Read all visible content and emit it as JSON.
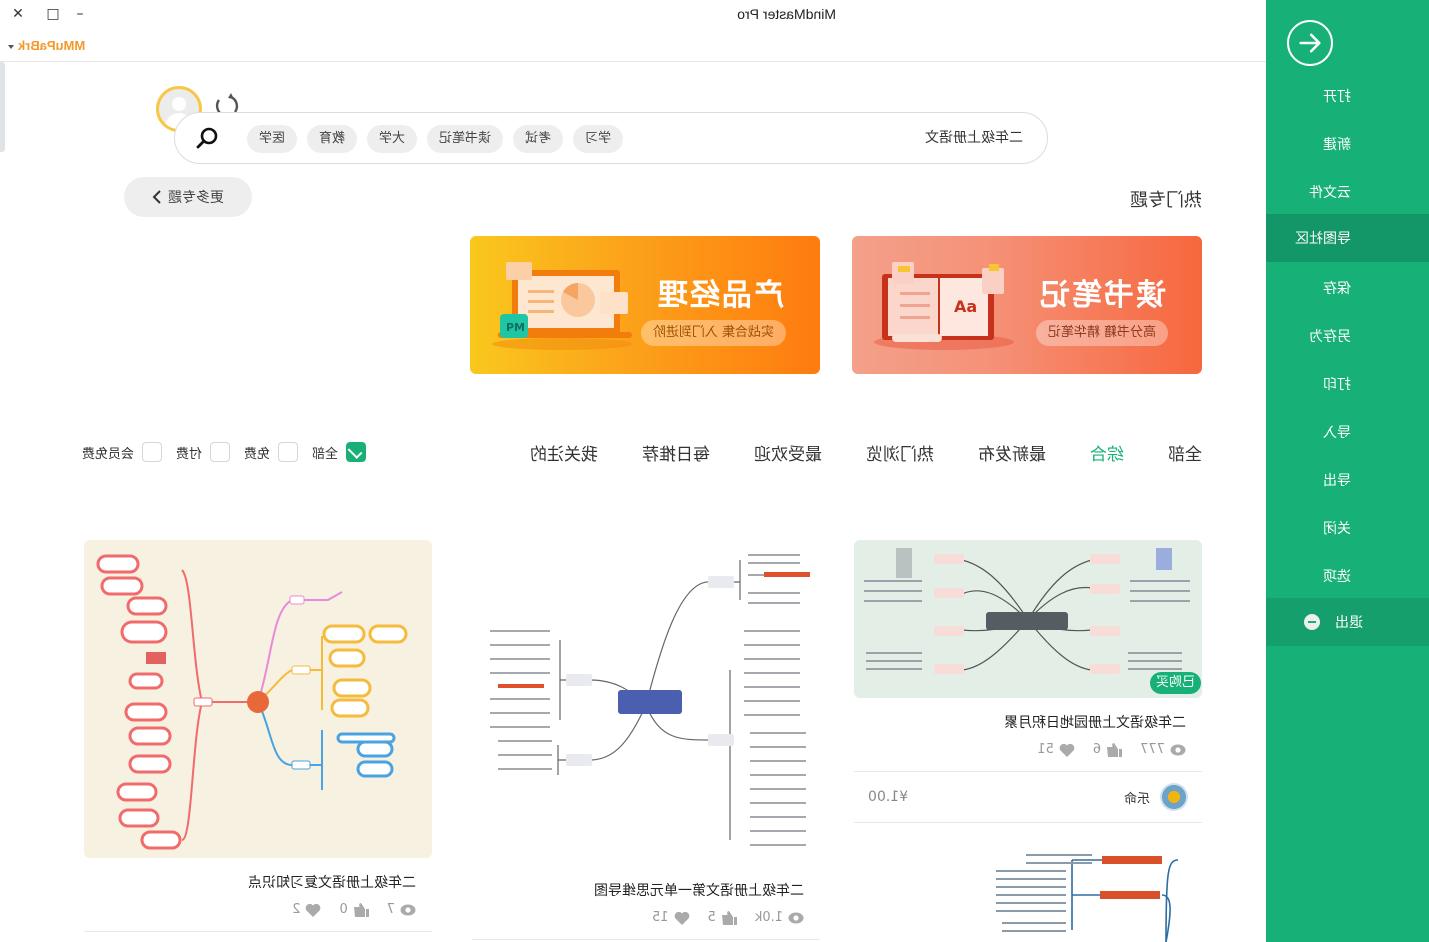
{
  "window": {
    "title": "MindMaster Pro",
    "minimize_label": "–",
    "maximize_label": "□",
    "close_label": "✕",
    "username": "MMuPaBrk"
  },
  "sidebar": {
    "back_icon": "arrow-right-circle-icon",
    "items": [
      {
        "label": "打开"
      },
      {
        "label": "新建"
      },
      {
        "label": "云文件"
      },
      {
        "label": "导图社区",
        "active": true
      },
      {
        "label": "保存"
      },
      {
        "label": "另存为"
      },
      {
        "label": "打印"
      },
      {
        "label": "导入"
      },
      {
        "label": "导出"
      },
      {
        "label": "关闭"
      },
      {
        "label": "选项"
      },
      {
        "label": "退出",
        "icon": "minus-circle-icon"
      }
    ]
  },
  "search": {
    "value": "二年级上册语文",
    "chips": [
      "学习",
      "考试",
      "读书笔记",
      "大学",
      "教育",
      "医学"
    ]
  },
  "hot_topics": {
    "title": "热门专题",
    "more_label": "更多专题",
    "banners": [
      {
        "title": "读书笔记",
        "subtitle": "高分书籍 精华笔记",
        "color_from": "#f7673d",
        "color_to": "#f4a08a"
      },
      {
        "title": "产品经理",
        "subtitle": "实战合集 入门到进阶",
        "badge": "PM",
        "color_from": "#ff7b0f",
        "color_to": "#f9c81d"
      }
    ]
  },
  "tabs": [
    {
      "label": "全部"
    },
    {
      "label": "综合",
      "active": true
    },
    {
      "label": "最新发布"
    },
    {
      "label": "热门浏览"
    },
    {
      "label": "最受欢迎"
    },
    {
      "label": "每日推荐"
    },
    {
      "label": "我关注的"
    }
  ],
  "filters": [
    {
      "label": "全部",
      "checked": true
    },
    {
      "label": "免费",
      "checked": false
    },
    {
      "label": "付费",
      "checked": false
    },
    {
      "label": "会员免费",
      "checked": false
    }
  ],
  "cards": [
    {
      "title": "二年级语文上册园地日积月累",
      "views": "777",
      "likes": "6",
      "favorites": "51",
      "author": "乐命",
      "price": "¥1.00",
      "badge": "已购买",
      "thumb_bg": "#e3efe6"
    },
    {
      "title": "二年级上册语文第一单元思维导图",
      "views": "1.0k",
      "likes": "5",
      "favorites": "15",
      "thumb_bg": "#ffffff"
    },
    {
      "title": "二年级上册语文复习知识点",
      "views": "7",
      "likes": "0",
      "favorites": "2",
      "thumb_bg": "#f6f1e1"
    }
  ],
  "colors": {
    "accent": "#17b077",
    "accent_dark": "#149768",
    "username": "#f39a2b"
  }
}
